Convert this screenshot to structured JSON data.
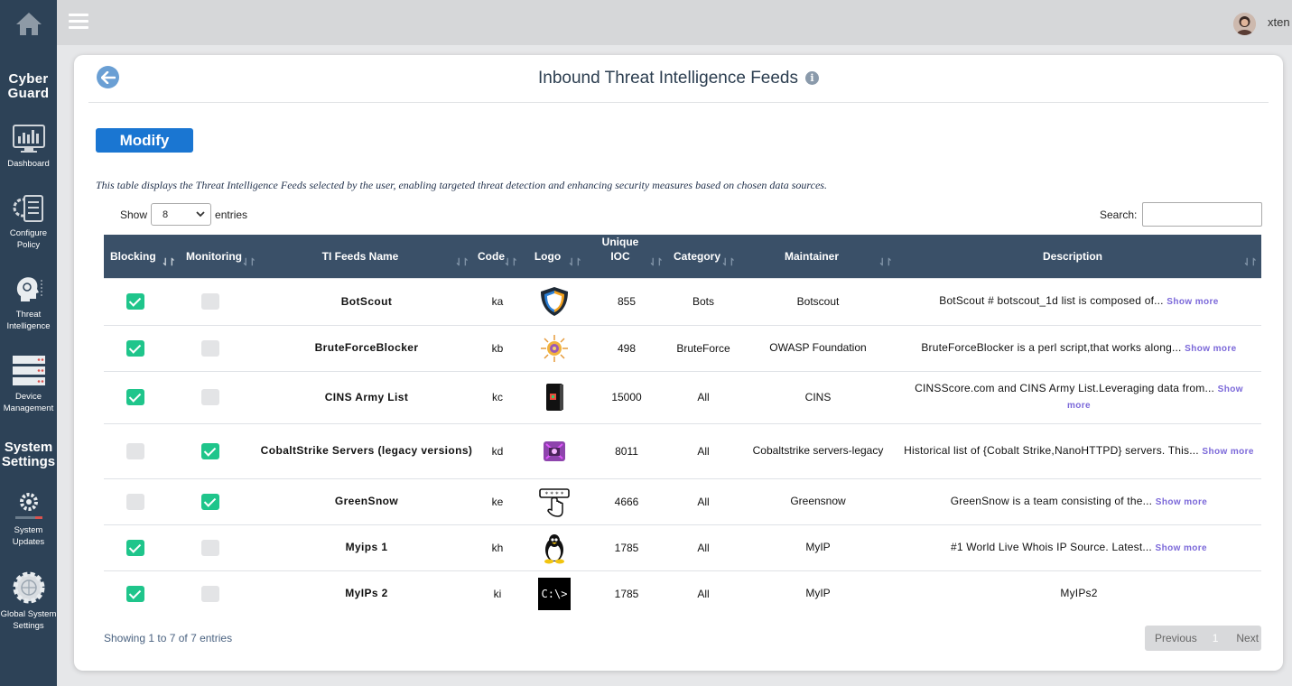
{
  "brand": {
    "line1": "Cyber",
    "line2": "Guard"
  },
  "sidebar": {
    "items": [
      {
        "label": "Dashboard"
      },
      {
        "label": "Configure Policy"
      },
      {
        "label": "Threat Intelligence"
      },
      {
        "label": "Device Management"
      }
    ],
    "section_heading": {
      "line1": "System",
      "line2": "Settings"
    },
    "items2": [
      {
        "label": "System Updates"
      },
      {
        "label": "Global System Settings"
      }
    ]
  },
  "topbar": {
    "username": "xten"
  },
  "page": {
    "title": "Inbound Threat Intelligence Feeds",
    "modify_label": "Modify",
    "description": "This table displays the Threat Intelligence Feeds selected by the user, enabling targeted threat detection and enhancing security measures based on chosen data sources.",
    "show_label": "Show",
    "show_value": "8",
    "entries_label": "entries",
    "search_label": "Search:",
    "search_value": ""
  },
  "table": {
    "headers": {
      "blocking": "Blocking",
      "monitoring": "Monitoring",
      "name": "TI Feeds Name",
      "code": "Code",
      "logo": "Logo",
      "uioc1": "Unique",
      "uioc2": "IOC",
      "category": "Category",
      "maintainer": "Maintainer",
      "description": "Description"
    },
    "show_more": "Show more",
    "rows": [
      {
        "blocking": true,
        "monitoring": false,
        "name": "BotScout",
        "code": "ka",
        "logo": "shield-logo",
        "ioc": "855",
        "category": "Bots",
        "maintainer": "Botscout",
        "desc": "BotScout # botscout_1d list is composed of...",
        "more": true
      },
      {
        "blocking": true,
        "monitoring": false,
        "name": "BruteForceBlocker",
        "code": "kb",
        "logo": "sun-logo",
        "ioc": "498",
        "category": "BruteForce",
        "maintainer": "OWASP Foundation",
        "desc": "BruteForceBlocker is a perl script,that works along...",
        "more": true
      },
      {
        "blocking": true,
        "monitoring": false,
        "name": "CINS Army List",
        "code": "kc",
        "logo": "book-logo",
        "ioc": "15000",
        "category": "All",
        "maintainer": "CINS",
        "desc": "CINSScore.com and CINS Army List.Leveraging data from...",
        "more": true
      },
      {
        "blocking": false,
        "monitoring": true,
        "name": "CobaltStrike Servers (legacy versions)",
        "code": "kd",
        "logo": "strike-logo",
        "ioc": "8011",
        "category": "All",
        "maintainer": "Cobaltstrike servers-legacy",
        "desc": "Historical list of {Cobalt Strike,NanoHTTPD} servers. This...",
        "more": true
      },
      {
        "blocking": false,
        "monitoring": true,
        "name": "GreenSnow",
        "code": "ke",
        "logo": "password-hand-logo",
        "ioc": "4666",
        "category": "All",
        "maintainer": "Greensnow",
        "desc": "GreenSnow is a team consisting of the...",
        "more": true
      },
      {
        "blocking": true,
        "monitoring": false,
        "name": "Myips 1",
        "code": "kh",
        "logo": "penguin-logo",
        "ioc": "1785",
        "category": "All",
        "maintainer": "MyIP",
        "desc": "#1 World Live Whois IP Source. Latest...",
        "more": true
      },
      {
        "blocking": true,
        "monitoring": false,
        "name": "MyIPs 2",
        "code": "ki",
        "logo": "terminal-logo",
        "ioc": "1785",
        "category": "All",
        "maintainer": "MyIP",
        "desc": "MyIPs2",
        "more": false
      }
    ]
  },
  "footer": {
    "showing": "Showing 1 to 7 of 7 entries",
    "previous": "Previous",
    "page": "1",
    "next": "Next"
  },
  "colors": {
    "sidebar": "#2d4257",
    "header": "#3a5068",
    "accent": "#1a76d2",
    "check_on": "#1fc58b",
    "show_more": "#7b68d9"
  }
}
